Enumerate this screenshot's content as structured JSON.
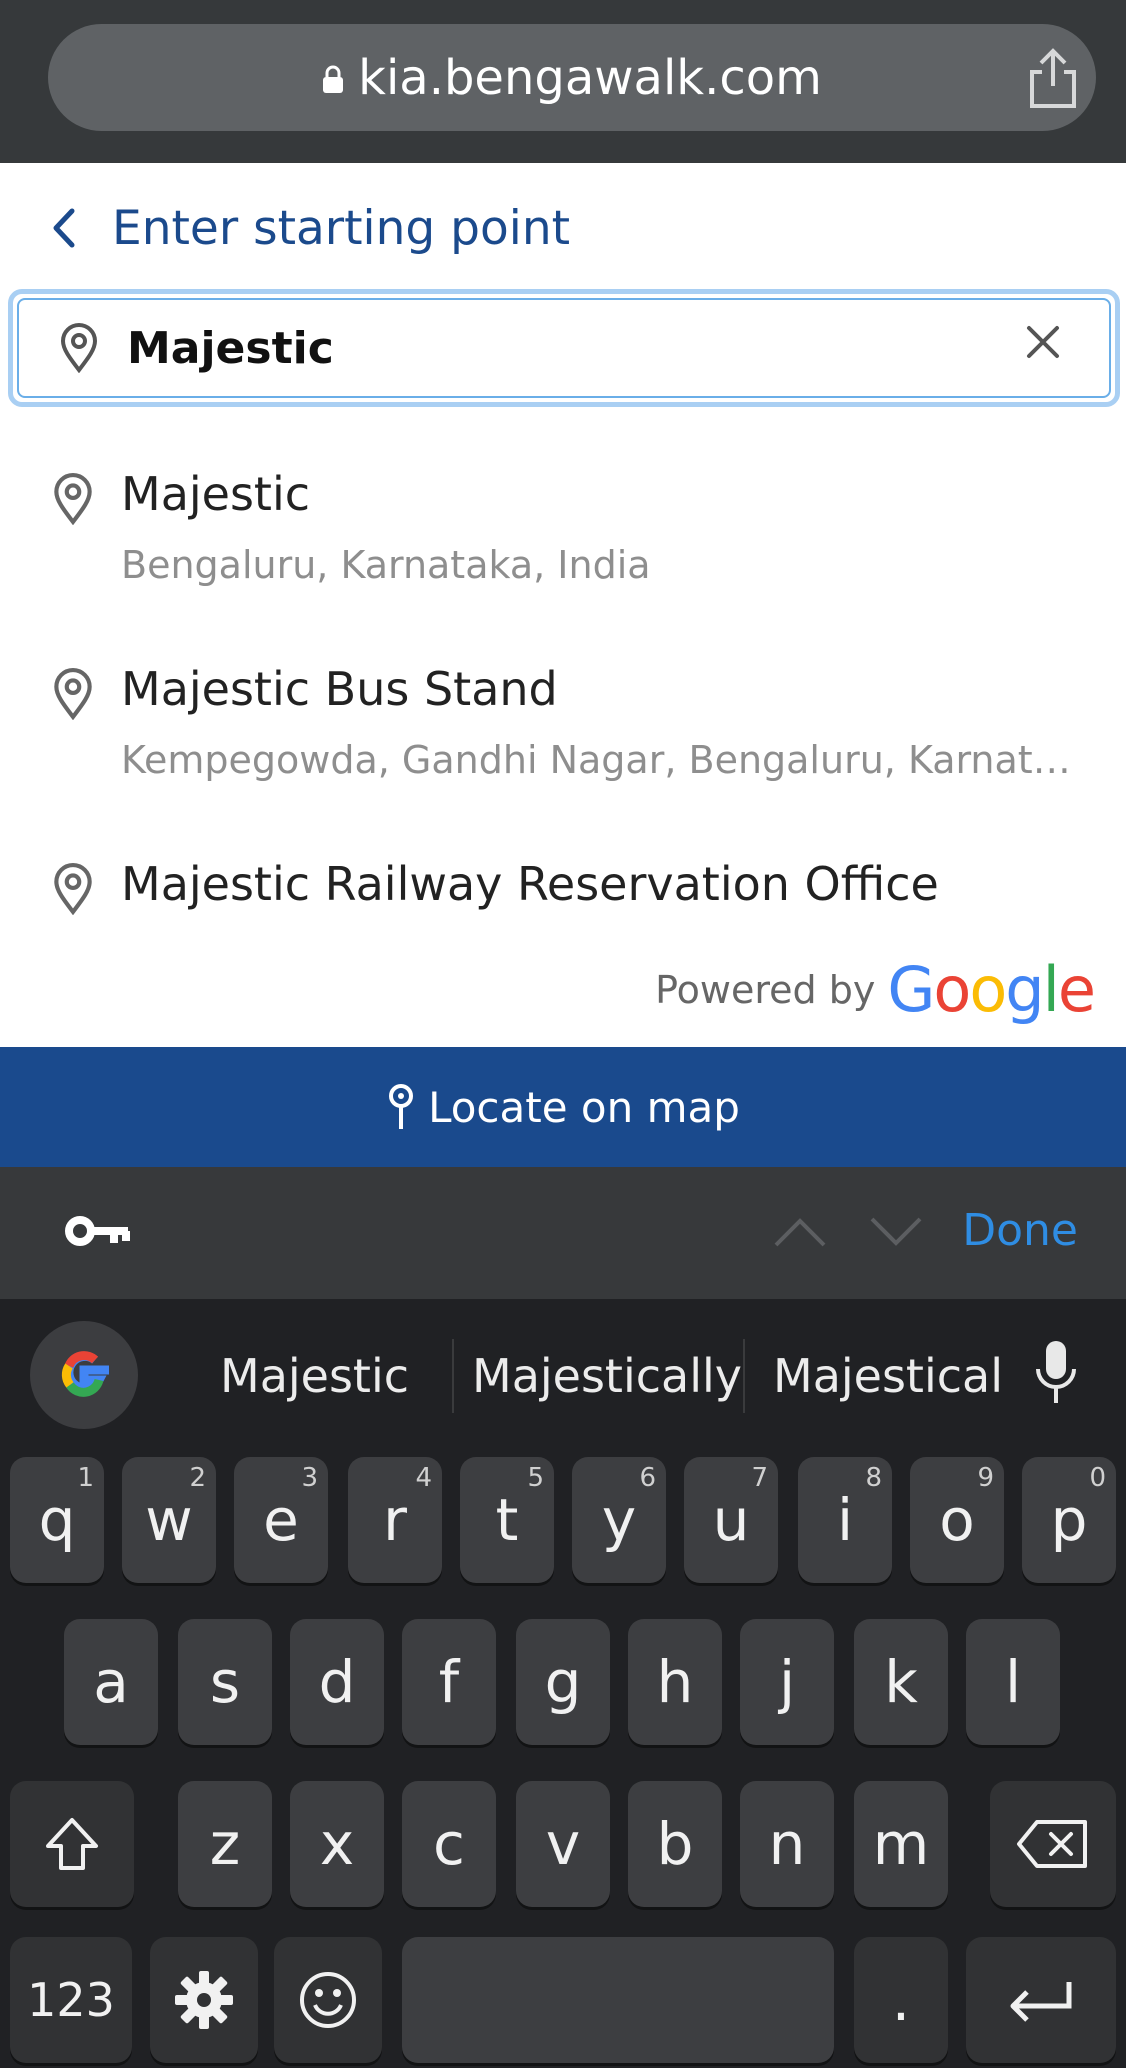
{
  "browser": {
    "url": "kia.bengawalk.com",
    "icons": [
      "lock-icon",
      "share-icon"
    ]
  },
  "header": {
    "title": "Enter starting point",
    "back_icon": "chevron-left-icon"
  },
  "search": {
    "value": "Majestic",
    "clear_icon": "close-icon"
  },
  "suggestions": [
    {
      "title": "Majestic",
      "subtitle": "Bengaluru, Karnataka, India"
    },
    {
      "title": "Majestic Bus Stand",
      "subtitle": "Kempegowda, Gandhi Nagar, Bengaluru, Karnataka, India"
    },
    {
      "title": "Majestic Railway Reservation Office",
      "subtitle": ""
    }
  ],
  "attribution": {
    "label": "Powered by",
    "brand": "Google",
    "brand_colors": [
      "#4285F4",
      "#EA4335",
      "#FBBC05",
      "#4285F4",
      "#34A853",
      "#EA4335"
    ]
  },
  "locate": {
    "label": "Locate on map"
  },
  "accessory": {
    "done_label": "Done"
  },
  "keyboard": {
    "suggestions": [
      "Majestic",
      "Majestically",
      "Majestical"
    ],
    "row1": [
      {
        "key": "q",
        "hint": "1"
      },
      {
        "key": "w",
        "hint": "2"
      },
      {
        "key": "e",
        "hint": "3"
      },
      {
        "key": "r",
        "hint": "4"
      },
      {
        "key": "t",
        "hint": "5"
      },
      {
        "key": "y",
        "hint": "6"
      },
      {
        "key": "u",
        "hint": "7"
      },
      {
        "key": "i",
        "hint": "8"
      },
      {
        "key": "o",
        "hint": "9"
      },
      {
        "key": "p",
        "hint": "0"
      }
    ],
    "row2": [
      "a",
      "s",
      "d",
      "f",
      "g",
      "h",
      "j",
      "k",
      "l"
    ],
    "row3": [
      "z",
      "x",
      "c",
      "v",
      "b",
      "n",
      "m"
    ],
    "numbers_label": "123",
    "period_label": "."
  },
  "colors": {
    "accent": "#1a4a8d",
    "done": "#2f8de3",
    "focus_ring": "#a9cff3"
  }
}
